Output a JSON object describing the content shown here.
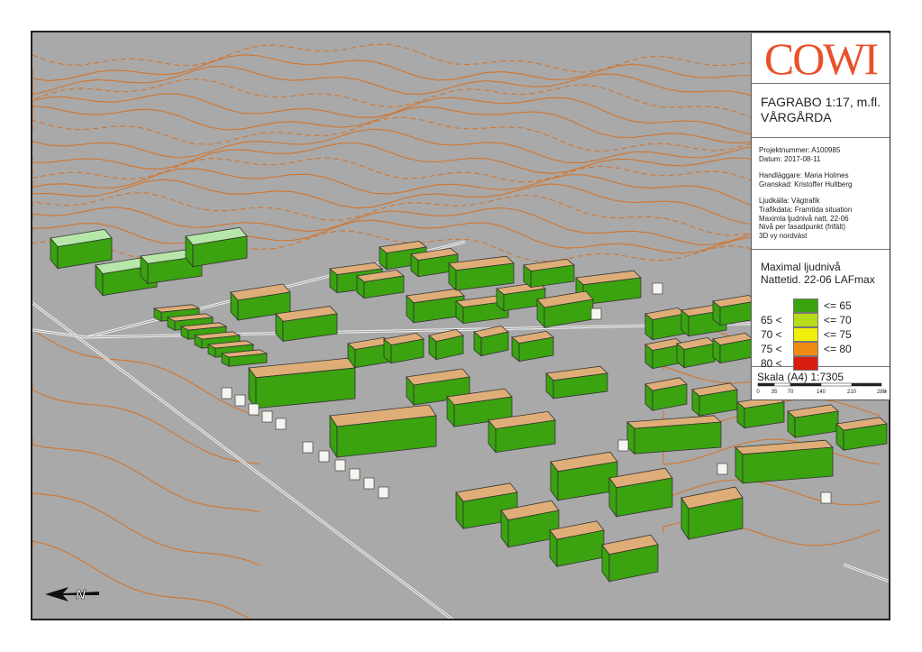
{
  "map": {
    "company_logo": "COWI",
    "title_line1": "FAGRABO 1:17, m.fl.",
    "title_line2": "VÅRGÅRDA",
    "project_number": "Projektnummer: A100985",
    "date": "Datum: 2017-08-11",
    "handler": "Handläggare: Maria Holmes",
    "reviewer": "Granskad: Kristoffer Hultberg",
    "noise_source": "Ljudkälla: Vägtrafik",
    "traffic_data": "Trafikdata: Framtida situation",
    "description1": "Maximla ljudnivå natt, 22-06",
    "description2": "Nivå per fasadpunkt (frifält)",
    "view": "3D vy nordväst",
    "legend_title1": "Maximal ljudnivå",
    "legend_title2": "Nattetid. 22-06 LAFmax",
    "legend": [
      {
        "low": "",
        "high": "<= 65",
        "color": "#3aa30f"
      },
      {
        "low": "65 <",
        "high": "<= 70",
        "color": "#b6dd1a"
      },
      {
        "low": "70 <",
        "high": "<= 75",
        "color": "#f2ee0c"
      },
      {
        "low": "75 <",
        "high": "<= 80",
        "color": "#ef8a14"
      },
      {
        "low": "80 <",
        "high": "",
        "color": "#d81d0f"
      }
    ],
    "scale_label": "Skala (A4) 1:7305",
    "scale_ticks": [
      "0",
      "35",
      "70",
      "140",
      "210",
      "280"
    ],
    "scale_unit": "m",
    "north_arrow": "N",
    "colors": {
      "ground": "#a9a9a9",
      "contour": "#d2752d",
      "roof": "#dfae78",
      "roof_unmodeled": "#b6e7a9",
      "facade": "#3aa30f",
      "road": "#f2f2f2",
      "logo": "#e9512b"
    }
  }
}
